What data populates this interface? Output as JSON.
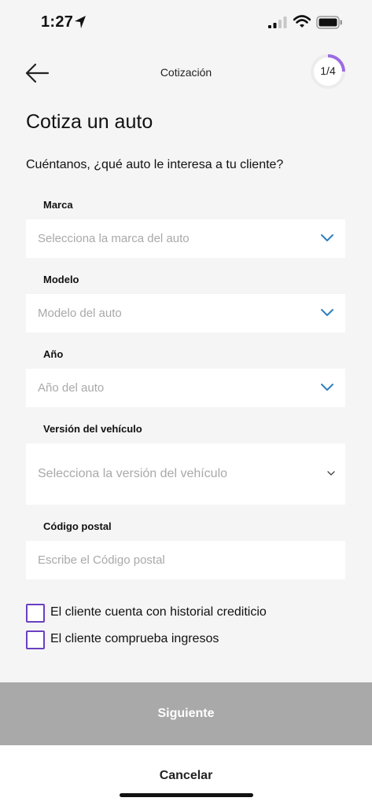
{
  "status_bar": {
    "time": "1:27"
  },
  "header": {
    "title": "Cotización",
    "progress": {
      "current": "1",
      "separator": "/",
      "total": "4",
      "fraction": 0.25,
      "color": "#9b6ce0"
    }
  },
  "page": {
    "title": "Cotiza un auto",
    "subtitle": "Cuéntanos, ¿qué auto le interesa a tu cliente?"
  },
  "form": {
    "marca": {
      "label": "Marca",
      "placeholder": "Selecciona la marca del auto"
    },
    "modelo": {
      "label": "Modelo",
      "placeholder": "Modelo del auto"
    },
    "anio": {
      "label": "Año",
      "placeholder": "Año del auto"
    },
    "version": {
      "label": "Versión del vehículo",
      "placeholder": "Selecciona la versión del vehículo"
    },
    "codigo_postal": {
      "label": "Código postal",
      "placeholder": "Escribe el Código postal"
    }
  },
  "checkboxes": [
    {
      "label": "El cliente cuenta con historial crediticio",
      "checked": false
    },
    {
      "label": "El cliente comprueba ingresos",
      "checked": false
    }
  ],
  "actions": {
    "next": "Siguiente",
    "cancel": "Cancelar"
  },
  "colors": {
    "accent": "#6a3fc1",
    "chevron": "#2f7fc1",
    "disabled_button": "#a9a9a9"
  }
}
